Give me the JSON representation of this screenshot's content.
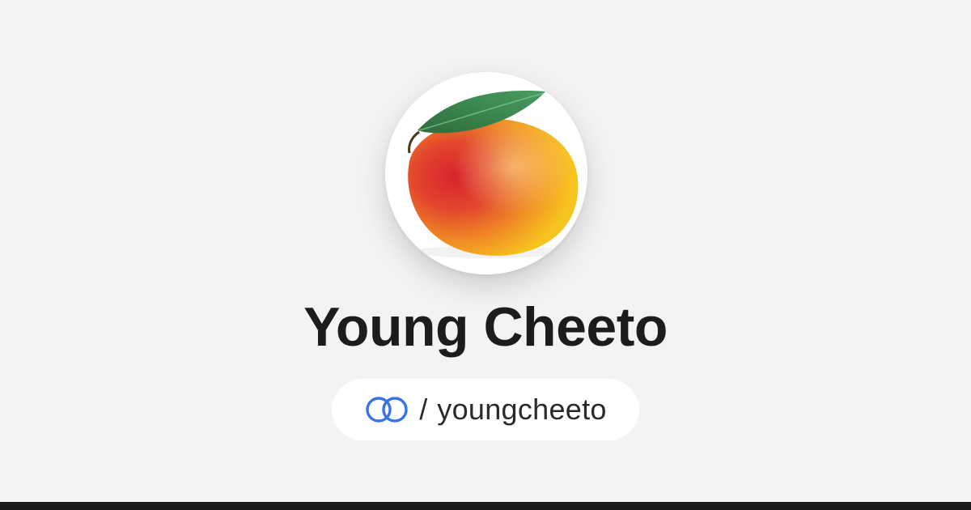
{
  "profile": {
    "display_name": "Young Cheeto",
    "handle_separator": "/",
    "handle": "youngcheeto",
    "avatar_subject": "mango-with-leaf",
    "brand_icon": "linked-rings-icon"
  },
  "colors": {
    "background": "#f3f3f5",
    "pill_background": "#ffffff",
    "name_text": "#1c1c1e",
    "handle_text": "#2a2a2c",
    "brand_blue": "#3a72e8",
    "bottom_bar": "#1b1b1d"
  }
}
